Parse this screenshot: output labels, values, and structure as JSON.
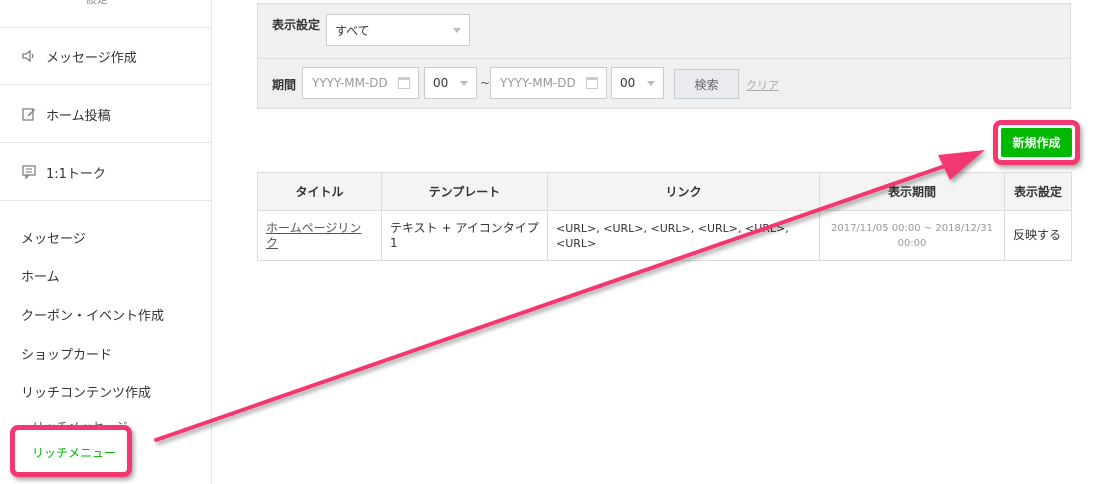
{
  "sidebar": {
    "top_stub": "設定",
    "blocks": [
      {
        "label": "メッセージ作成",
        "icon": "speaker-icon"
      },
      {
        "label": "ホーム投稿",
        "icon": "edit-icon"
      },
      {
        "label": "1:1トーク",
        "icon": "chat-icon"
      }
    ],
    "links": [
      "メッセージ",
      "ホーム",
      "クーポン・イベント作成",
      "ショップカード",
      "リッチコンテンツ作成"
    ],
    "sub_items": [
      "リッチメッセージ"
    ],
    "active_item": "リッチメニュー"
  },
  "filter": {
    "display_label": "表示設定",
    "display_value": "すべて",
    "period_label": "期間",
    "start_date_placeholder": "YYYY-MM-DD",
    "start_hour": "00",
    "tilde": "~",
    "end_date_placeholder": "YYYY-MM-DD",
    "end_hour": "00",
    "search_label": "検索",
    "clear_label": "クリア"
  },
  "new_button_label": "新規作成",
  "table": {
    "headers": [
      "タイトル",
      "テンプレート",
      "リンク",
      "表示期間",
      "表示設定"
    ],
    "rows": [
      {
        "title": "ホームページリンク",
        "template": "テキスト + アイコンタイプ 1",
        "link": "<URL>, <URL>, <URL>, <URL>, <URL>, <URL>",
        "period": "2017/11/05 00:00 ~ 2018/12/31 00:00",
        "status": "反映する"
      }
    ]
  },
  "colors": {
    "accent_green": "#00b900",
    "highlight_pink": "#f2386e"
  }
}
